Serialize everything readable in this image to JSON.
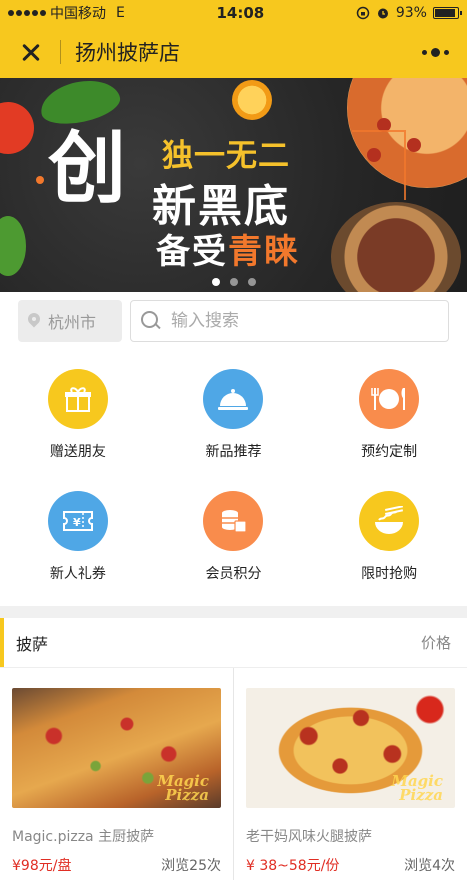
{
  "status_bar": {
    "carrier": "中国移动",
    "network": "E",
    "time": "14:08",
    "battery": "93%",
    "battery_level": 0.93
  },
  "nav": {
    "title": "扬州披萨店",
    "close_icon": "close-icon",
    "menu_icon": "more-menu-icon"
  },
  "banner": {
    "big_char": "创",
    "line1": "独一无二",
    "line2": "新黑底",
    "line3_prefix": "备受",
    "line3_highlight": "青睐",
    "pages": 3,
    "active_page": 1
  },
  "search": {
    "city": "杭州市",
    "placeholder": "输入搜索"
  },
  "quick_links": [
    {
      "label": "赠送朋友",
      "icon": "gift-icon",
      "color": "#f7c81e"
    },
    {
      "label": "新品推荐",
      "icon": "cloche-icon",
      "color": "#4fa7e6"
    },
    {
      "label": "预约定制",
      "icon": "plate-cutlery-icon",
      "color": "#f98c4c"
    },
    {
      "label": "新人礼券",
      "icon": "coupon-icon",
      "color": "#4fa7e6"
    },
    {
      "label": "会员积分",
      "icon": "coins-icon",
      "color": "#f98c4c"
    },
    {
      "label": "限时抢购",
      "icon": "noodle-bowl-icon",
      "color": "#f7c81e"
    }
  ],
  "section": {
    "title": "披萨",
    "right_label": "价格"
  },
  "products": [
    {
      "name": "Magic.pizza 主厨披萨",
      "price": "¥98元/盘",
      "views": "浏览25次",
      "watermark_1": "Magic",
      "watermark_2": "Pizza"
    },
    {
      "name": "老干妈风味火腿披萨",
      "price": "¥ 38~58元/份",
      "views": "浏览4次",
      "watermark_1": "Magic",
      "watermark_2": "Pizza"
    }
  ],
  "colors": {
    "brand_yellow": "#f7c81e",
    "price_red": "#e02e24",
    "accent_orange": "#f2782c"
  }
}
